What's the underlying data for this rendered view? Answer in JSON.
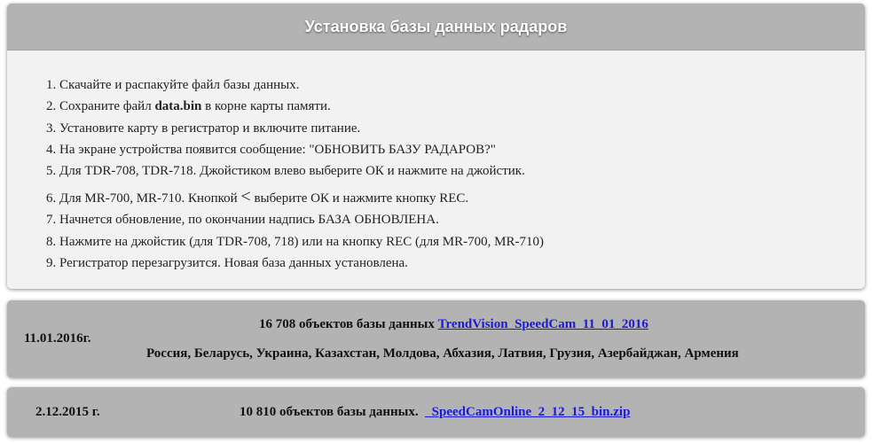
{
  "header": {
    "title": "Установка базы данных радаров"
  },
  "steps": [
    {
      "num": "1.",
      "text": "Скачайте и распакуйте файл базы данных."
    },
    {
      "num": "2.",
      "before": "Сохраните файл ",
      "bold": "data.bin",
      "after": " в корне карты памяти."
    },
    {
      "num": "3.",
      "text": "Установите карту в регистратор и включите питание."
    },
    {
      "num": "4.",
      "text": "На экране устройства появится сообщение: \"ОБНОВИТЬ БАЗУ РАДАРОВ?\""
    },
    {
      "num": "5.",
      "text": "Для TDR-708, TDR-718. Джойстиком влево  выберите ОК и нажмите на джойстик."
    },
    {
      "num": "6.",
      "before": "Для MR-700, MR-710. Кнопкой ",
      "glyph": "<",
      "after": " выберите ОК  и нажмите кнопку REC."
    },
    {
      "num": "7.",
      "text": "Начнется обновление, по окончании надпись БАЗА ОБНОВЛЕНА."
    },
    {
      "num": "8.",
      "text": "Нажмите на джойстик (для TDR-708, 718) или на кнопку REC (для MR-700, MR-710)"
    },
    {
      "num": "9.",
      "text": "Регистратор перезагрузится. Новая база данных установлена."
    }
  ],
  "databases": [
    {
      "date": "11.01.2016г.",
      "count_text": "16 708 объектов базы данных ",
      "link_text": "TrendVision_SpeedCam_11_01_2016",
      "countries": "Россия, Беларусь, Украина, Казахстан, Молдова, Абхазия, Латвия, Грузия, Азербайджан, Армения"
    },
    {
      "date": "2.12.2015 г.",
      "count_text": "10 810 объектов базы данных.  ",
      "link_text": "_SpeedCamOnline_2_12_15_bin.zip"
    }
  ],
  "colors": {
    "header_bg": "#b3b3b3",
    "body_bg": "#f2f2f2",
    "link": "#1a1ad8"
  }
}
